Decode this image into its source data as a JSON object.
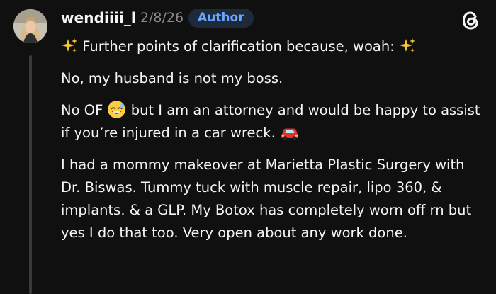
{
  "post": {
    "username": "wendiiii_l",
    "date": "2/8/26",
    "badge": "Author",
    "paragraphs": {
      "p1": "Further points of clarification because, woah:",
      "p2": "No, my husband is not my boss.",
      "p3a": "No OF",
      "p3b": "but I am an attorney and would be happy to assist if you’re injured in a car wreck.",
      "p4": "I had a mommy makeover at Marietta Plastic Surgery with Dr. Biswas. Tummy tuck with muscle repair, lipo 360, & implants. & a GLP. My Botox has completely worn off rn but yes I do that too. Very open about any work done."
    },
    "icons": {
      "sparkles": "sparkles-icon",
      "sweat_smile": "grinning-sweat-icon",
      "car": "red-car-icon",
      "app": "threads-logo-icon"
    }
  },
  "colors": {
    "background": "#101010",
    "text": "#f3f5f7",
    "muted": "#8a8a8a",
    "badge_bg": "#1e2a3a",
    "badge_text": "#6aa8ff",
    "thread_line": "#3a3a3a"
  }
}
